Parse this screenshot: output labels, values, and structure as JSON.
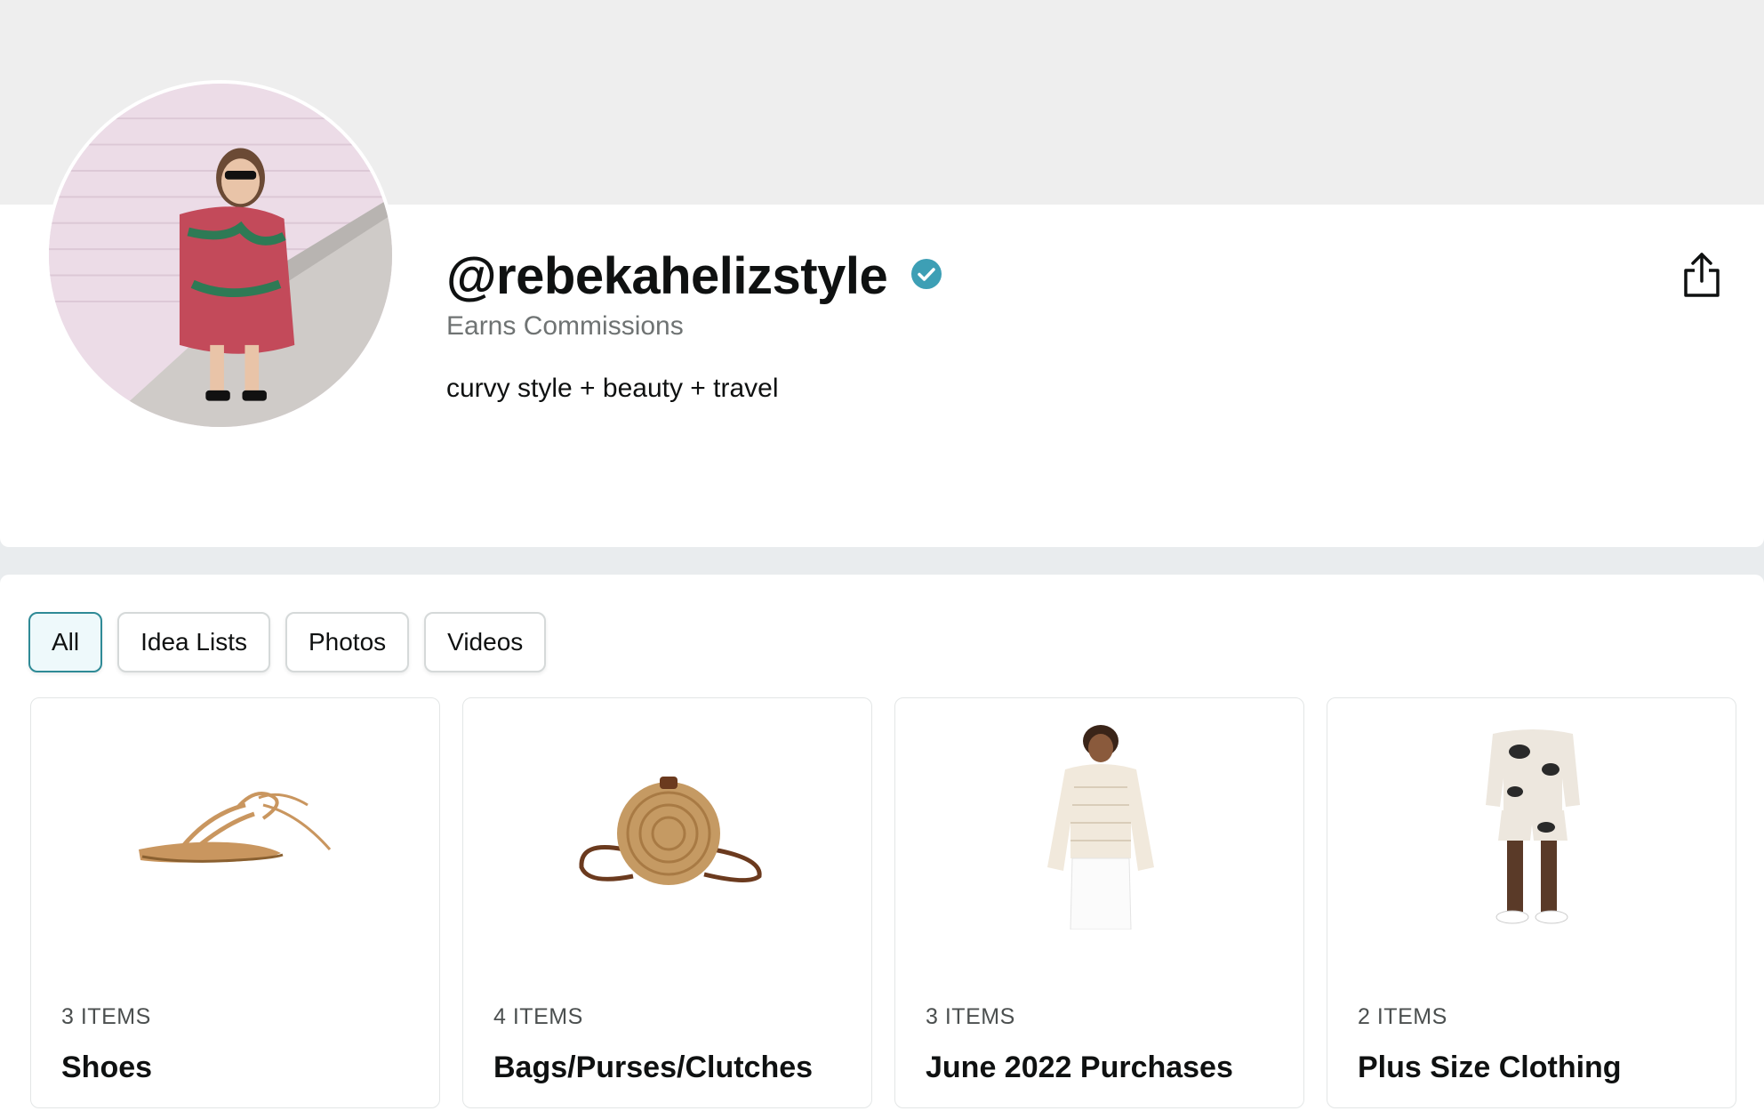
{
  "profile": {
    "handle": "@rebekahelizstyle",
    "earns_label": "Earns Commissions",
    "bio": "curvy style + beauty + travel",
    "verified_icon": "verified-check-icon",
    "share_icon": "share-icon",
    "verified_color": "#3d9fb5"
  },
  "tabs": [
    {
      "label": "All",
      "active": true
    },
    {
      "label": "Idea Lists",
      "active": false
    },
    {
      "label": "Photos",
      "active": false
    },
    {
      "label": "Videos",
      "active": false
    }
  ],
  "lists": [
    {
      "count": "3 ITEMS",
      "title": "Shoes",
      "image": "lace-up-sandal"
    },
    {
      "count": "4 ITEMS",
      "title": "Bags/Purses/Clutches",
      "image": "round-rattan-bag"
    },
    {
      "count": "3 ITEMS",
      "title": "June 2022 Purchases",
      "image": "crochet-sweater"
    },
    {
      "count": "2 ITEMS",
      "title": "Plus Size Clothing",
      "image": "tie-dye-shorts-set"
    }
  ],
  "colors": {
    "accent": "#2e8a96",
    "active_tab_bg": "#eef9fb",
    "page_bg": "#e9ecee"
  }
}
